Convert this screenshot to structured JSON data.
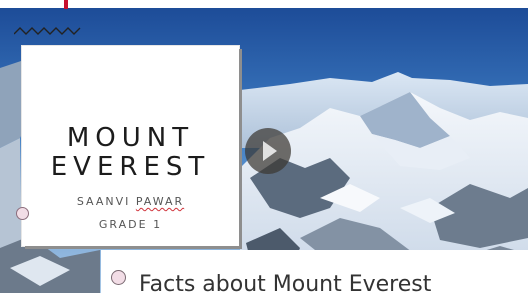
{
  "title_card": {
    "title_line1": "MOUNT",
    "title_line2": "EVEREST",
    "author_first": "SAANVI",
    "author_last": "PAWAR",
    "grade": "GRADE 1"
  },
  "media": {
    "play_icon": "play-icon"
  },
  "bullet": {
    "text": "Facts about Mount Everest"
  },
  "colors": {
    "accent": "#c8102e",
    "bullet_fill": "#f2dde6",
    "sky_top": "#1e4f9c"
  }
}
